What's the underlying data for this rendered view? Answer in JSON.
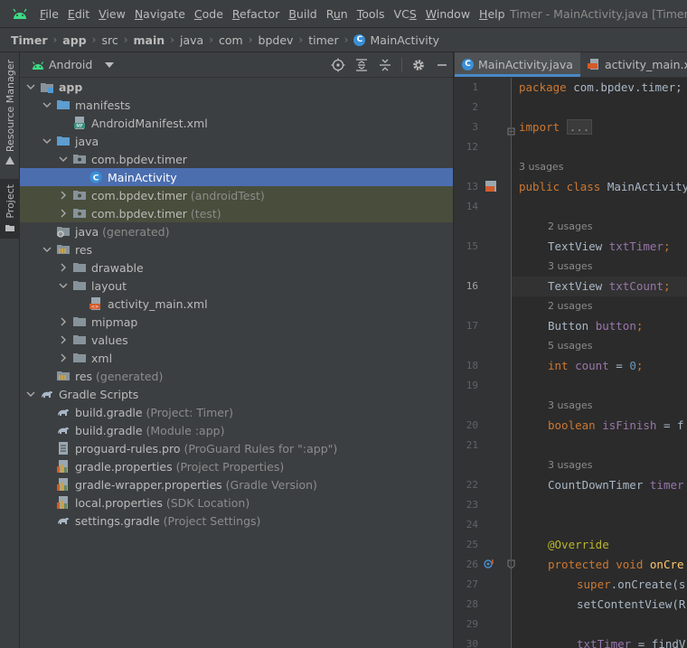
{
  "menubar": {
    "items": [
      "File",
      "Edit",
      "View",
      "Navigate",
      "Code",
      "Refactor",
      "Build",
      "Run",
      "Tools",
      "VCS",
      "Window",
      "Help"
    ],
    "mnemonics": [
      "F",
      "E",
      "V",
      "N",
      "C",
      "R",
      "B",
      "u",
      "T",
      "S",
      "W",
      "H"
    ],
    "title": "Timer - MainActivity.java [Timer.app"
  },
  "breadcrumb": {
    "items": [
      "Timer",
      "app",
      "src",
      "main",
      "java",
      "com",
      "bpdev",
      "timer",
      "MainActivity"
    ]
  },
  "toolstrip": {
    "resource_manager": "Resource Manager",
    "project": "Project"
  },
  "project_panel": {
    "view": "Android"
  },
  "tree": [
    {
      "label": "app",
      "sub": ""
    },
    {
      "label": "manifests",
      "sub": ""
    },
    {
      "label": "AndroidManifest.xml",
      "sub": ""
    },
    {
      "label": "java",
      "sub": ""
    },
    {
      "label": "com.bpdev.timer",
      "sub": ""
    },
    {
      "label": "MainActivity",
      "sub": ""
    },
    {
      "label": "com.bpdev.timer",
      "sub": " (androidTest)"
    },
    {
      "label": "com.bpdev.timer",
      "sub": " (test)"
    },
    {
      "label": "java",
      "sub": " (generated)"
    },
    {
      "label": "res",
      "sub": ""
    },
    {
      "label": "drawable",
      "sub": ""
    },
    {
      "label": "layout",
      "sub": ""
    },
    {
      "label": "activity_main.xml",
      "sub": ""
    },
    {
      "label": "mipmap",
      "sub": ""
    },
    {
      "label": "values",
      "sub": ""
    },
    {
      "label": "xml",
      "sub": ""
    },
    {
      "label": "res",
      "sub": " (generated)"
    },
    {
      "label": "Gradle Scripts",
      "sub": ""
    },
    {
      "label": "build.gradle",
      "sub": " (Project: Timer)"
    },
    {
      "label": "build.gradle",
      "sub": " (Module :app)"
    },
    {
      "label": "proguard-rules.pro",
      "sub": " (ProGuard Rules for \":app\")"
    },
    {
      "label": "gradle.properties",
      "sub": " (Project Properties)"
    },
    {
      "label": "gradle-wrapper.properties",
      "sub": " (Gradle Version)"
    },
    {
      "label": "local.properties",
      "sub": " (SDK Location)"
    },
    {
      "label": "settings.gradle",
      "sub": " (Project Settings)"
    }
  ],
  "editor": {
    "tabs": [
      "MainActivity.java",
      "activity_main.xml"
    ],
    "line_numbers": [
      "1",
      "2",
      "3",
      "12",
      "13",
      "14",
      "15",
      "16",
      "17",
      "18",
      "19",
      "20",
      "21",
      "22",
      "23",
      "24",
      "25",
      "26",
      "27",
      "28",
      "29",
      "30"
    ],
    "hints": [
      "3 usages",
      "2 usages",
      "3 usages",
      "2 usages",
      "5 usages",
      "3 usages",
      "3 usages"
    ],
    "code": {
      "l1a": "package",
      "l1b": " com.bpdev.timer;",
      "l3a": "import",
      "l3b": "...",
      "l13a": "public class",
      "l13b": " MainActivity",
      "l15a": "TextView ",
      "l15b": "txtTimer",
      "l15c": ";",
      "l16a": "TextView ",
      "l16b": "txtCount",
      "l16c": ";",
      "l17a": "Button ",
      "l17b": "button",
      "l17c": ";",
      "l18a": "int ",
      "l18b": "count",
      "l18c": " = ",
      "l18d": "0",
      "l18e": ";",
      "l20a": "boolean ",
      "l20b": "isFinish",
      "l20c": " = f",
      "l22a": "CountDownTimer ",
      "l22b": "timer",
      "l25a": "@Override",
      "l26a": "protected void ",
      "l26b": "onCre",
      "l27a": "super",
      "l27b": ".onCreate(s",
      "l28a": "setContentView(R",
      "l30a": "txtTimer",
      "l30b": " = findV"
    }
  }
}
